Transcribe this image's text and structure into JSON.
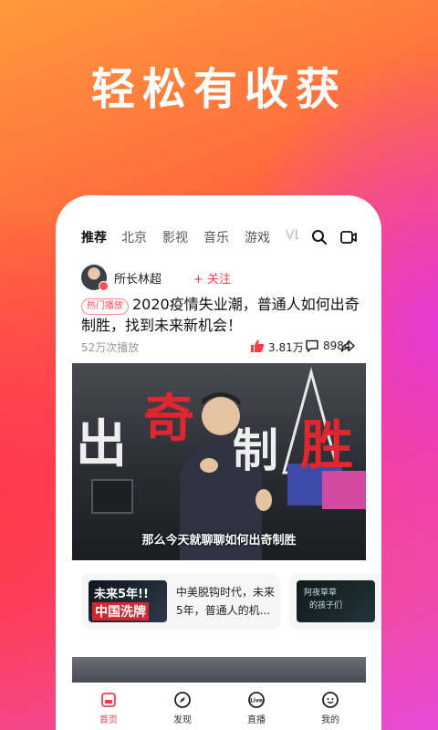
{
  "headline": "轻松有收获",
  "tabs": [
    "推荐",
    "北京",
    "影视",
    "音乐",
    "游戏",
    "VL"
  ],
  "post": {
    "author": "所长林超",
    "follow_label": "+ 关注",
    "badge": "热门播放",
    "title": "2020疫情失业潮，普通人如何出奇制胜，找到未来新机会！",
    "plays": "52万次播放",
    "likes": "3.81万",
    "comments": "8984"
  },
  "video": {
    "caption": "那么今天就聊聊如何出奇制胜",
    "overlay_title": "出奇制胜"
  },
  "recommendations": [
    {
      "thumb_line1": "未来5年!!",
      "thumb_line2": "中国洗牌",
      "text": "中美脱钩时代，未来5年，普通人的机..."
    },
    {
      "thumb_line1": "阿夜草草",
      "thumb_line2": "的孩子们"
    }
  ],
  "bottom_nav": [
    {
      "label": "首页",
      "icon": "home-icon"
    },
    {
      "label": "发现",
      "icon": "compass-icon"
    },
    {
      "label": "直播",
      "icon": "live-icon"
    },
    {
      "label": "我的",
      "icon": "profile-icon"
    }
  ],
  "colors": {
    "accent": "#ff3b4a"
  }
}
